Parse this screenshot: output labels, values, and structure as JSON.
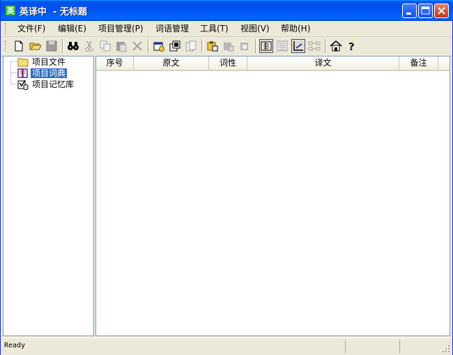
{
  "window": {
    "title": "英译中  - 无标题",
    "app_icon_glyph": "英"
  },
  "menu": [
    {
      "label": "文件(F)"
    },
    {
      "label": "编辑(E)"
    },
    {
      "label": "项目管理(P)"
    },
    {
      "label": "词语管理"
    },
    {
      "label": "工具(T)"
    },
    {
      "label": "视图(V)"
    },
    {
      "label": "帮助(H)"
    }
  ],
  "toolbar": {
    "buttons": [
      {
        "name": "new-file-icon"
      },
      {
        "name": "open-folder-icon"
      },
      {
        "name": "save-icon"
      },
      {
        "name": "find-binoculars-icon"
      },
      {
        "name": "cut-icon"
      },
      {
        "name": "copy-icon"
      },
      {
        "name": "paste-icon"
      },
      {
        "name": "delete-icon"
      },
      {
        "name": "add-item-icon"
      },
      {
        "name": "import-icon"
      },
      {
        "name": "export-icon"
      },
      {
        "name": "dictionary-add-icon"
      },
      {
        "name": "dictionary-edit-icon"
      },
      {
        "name": "dictionary-remove-icon"
      },
      {
        "name": "view-list-icon"
      },
      {
        "name": "view-text-icon"
      },
      {
        "name": "view-aligned-icon"
      },
      {
        "name": "view-pairs-icon"
      },
      {
        "name": "home-icon"
      },
      {
        "name": "help-icon"
      }
    ]
  },
  "tree": {
    "items": [
      {
        "label": "项目文件",
        "icon": "folder-icon",
        "selected": false
      },
      {
        "label": "项目词典",
        "icon": "dictionary-book-icon",
        "selected": true
      },
      {
        "label": "项目记忆库",
        "icon": "memory-database-icon",
        "selected": false
      }
    ]
  },
  "table": {
    "columns": [
      {
        "label": "序号"
      },
      {
        "label": "原文"
      },
      {
        "label": "词性"
      },
      {
        "label": "译文"
      },
      {
        "label": "备注"
      }
    ],
    "rows": []
  },
  "status": {
    "text": "Ready"
  },
  "colors": {
    "titlebar": "#0053ee",
    "selection": "#316ac5",
    "chrome": "#ece9d8"
  }
}
